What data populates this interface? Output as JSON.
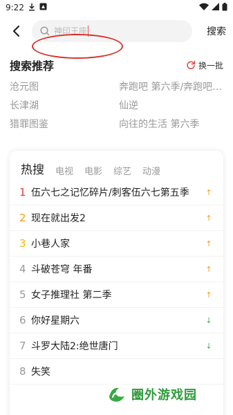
{
  "status": {
    "time": "9:22"
  },
  "search": {
    "placeholder": "神印王座",
    "button": "搜索"
  },
  "recommend": {
    "title": "搜索推荐",
    "refresh": "换一批",
    "items": [
      "沧元图",
      "奔跑吧 第六季/奔跑吧…",
      "长津湖",
      "仙逆",
      "猎罪图鉴",
      "向往的生活 第六季"
    ]
  },
  "hot": {
    "tabs": [
      "热搜",
      "电视",
      "电影",
      "综艺",
      "动漫"
    ],
    "items": [
      {
        "rank": "1",
        "title": "伍六七之记忆碎片/刺客伍六七第五季",
        "trend": "up"
      },
      {
        "rank": "2",
        "title": "现在就出发2",
        "trend": "up"
      },
      {
        "rank": "3",
        "title": "小巷人家",
        "trend": "up"
      },
      {
        "rank": "4",
        "title": "斗破苍穹 年番",
        "trend": "up"
      },
      {
        "rank": "5",
        "title": "女子推理社 第二季",
        "trend": "up"
      },
      {
        "rank": "6",
        "title": "你好星期六",
        "trend": "down"
      },
      {
        "rank": "7",
        "title": "斗罗大陆2:绝世唐门",
        "trend": "down"
      },
      {
        "rank": "8",
        "title": "失笑",
        "trend": ""
      }
    ]
  },
  "watermark": {
    "text": "圈外游戏园"
  },
  "colors": {
    "accent": "#e64a4a",
    "up": "#f39c12",
    "down": "#4caf50"
  }
}
